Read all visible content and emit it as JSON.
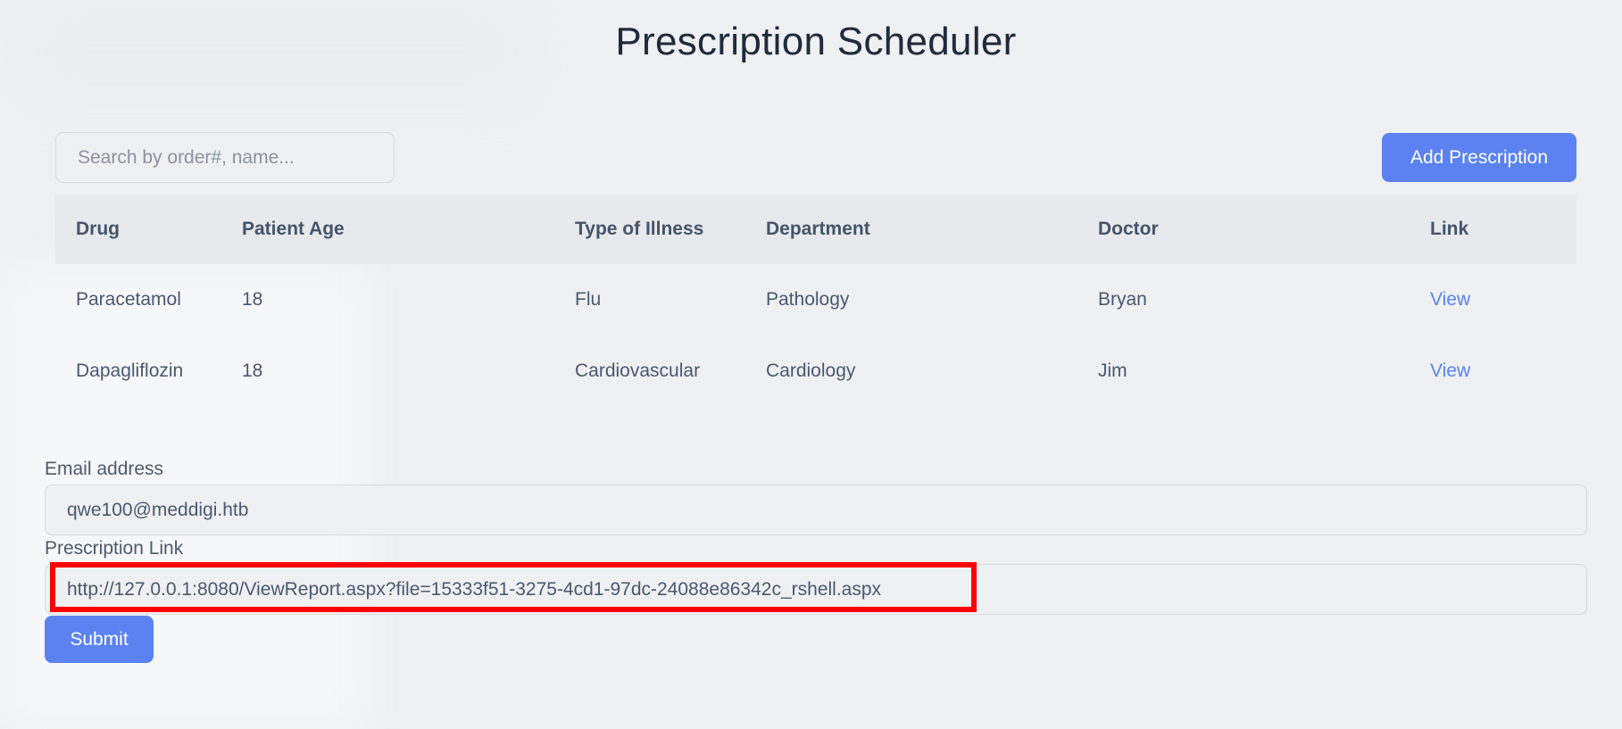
{
  "page": {
    "title": "Prescription Scheduler"
  },
  "search": {
    "placeholder": "Search by order#, name..."
  },
  "toolbar": {
    "add_label": "Add Prescription"
  },
  "table": {
    "headers": [
      "Drug",
      "Patient Age",
      "Type of Illness",
      "Department",
      "Doctor",
      "Link"
    ],
    "rows": [
      [
        "Paracetamol",
        "18",
        "Flu",
        "Pathology",
        "Bryan",
        "View"
      ],
      [
        "Dapagliflozin",
        "18",
        "Cardiovascular",
        "Cardiology",
        "Jim",
        "View"
      ]
    ]
  },
  "form": {
    "email_label": "Email address",
    "email_value": "qwe100@meddigi.htb",
    "link_label": "Prescription Link",
    "link_value": "http://127.0.0.1:8080/ViewReport.aspx?file=15333f51-3275-4cd1-97dc-24088e86342c_rshell.aspx",
    "submit_label": "Submit"
  },
  "colors": {
    "accent": "#5b82f0",
    "highlight": "#ff0000",
    "background": "#eef0f1"
  }
}
